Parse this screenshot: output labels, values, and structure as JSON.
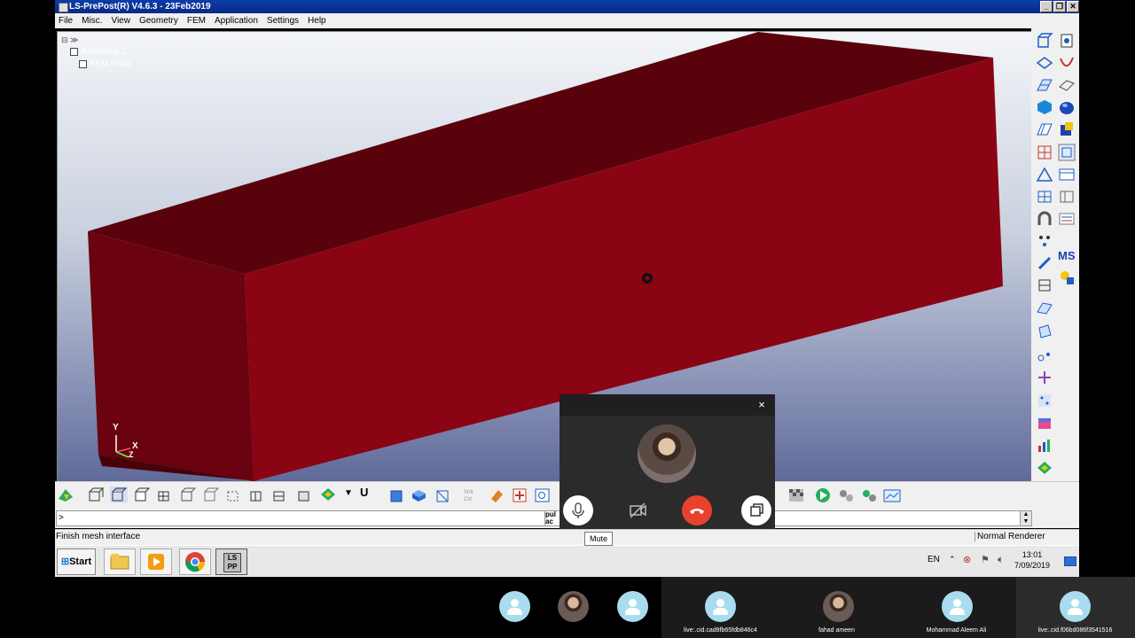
{
  "window": {
    "title": "LS-PrePost(R) V4.6.3 - 23Feb2019",
    "controls": [
      "_",
      "❐",
      "✕"
    ]
  },
  "menu": [
    "File",
    "Misc.",
    "View",
    "Geometry",
    "FEM",
    "Application",
    "Settings",
    "Help"
  ],
  "tree": {
    "assembly": "Assembly 1",
    "parts": "FEM Parts"
  },
  "axis": {
    "y": "Y",
    "x": "X",
    "z": "Z"
  },
  "command_line": {
    "prompt": ">",
    "side_text_1": "pul",
    "side_text_2": "ac"
  },
  "status": {
    "message": "Finish mesh interface",
    "renderer": "Normal Renderer"
  },
  "taskbar": {
    "start": "Start",
    "lang": "EN",
    "time": "13:01",
    "date": "7/09/2019",
    "lsprepost_icon": "LS PP"
  },
  "call": {
    "close": "×",
    "mute_tooltip": "Mute",
    "colors": {
      "end_call": "#e8412d",
      "panel": "#2b2b2b"
    }
  },
  "participants": [
    {
      "name": "",
      "avatar": "generic-avatar"
    },
    {
      "name": "",
      "avatar": "photo-avatar"
    },
    {
      "name": "",
      "avatar": "generic-avatar"
    },
    {
      "name": "live:.cid.cad8fb65fdb846c4",
      "avatar": "generic-avatar"
    },
    {
      "name": "fahad ameen",
      "avatar": "photo-avatar"
    },
    {
      "name": "Mohammad Aleem Ali",
      "avatar": "generic-avatar"
    },
    {
      "name": "live:.cid.f06bd086f3541516",
      "avatar": "generic-avatar"
    }
  ],
  "colors": {
    "box_front": "#8a0413",
    "box_top": "#5a020c",
    "box_left": "#6a030f",
    "titlebar": "#0b3da8"
  }
}
